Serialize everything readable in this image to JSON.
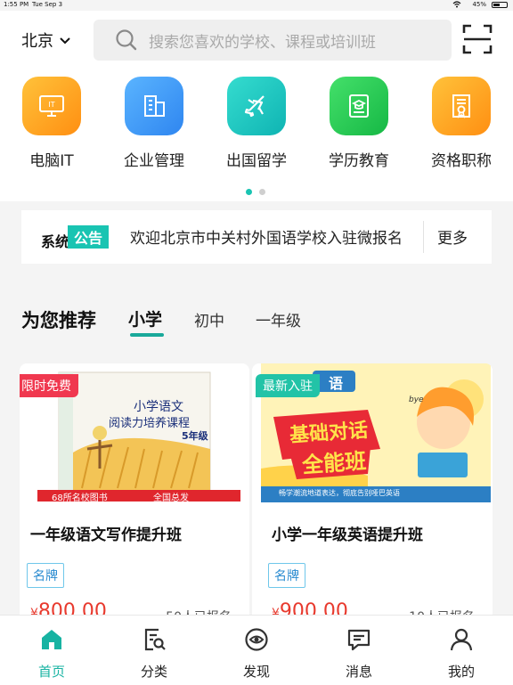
{
  "status_bar": {
    "time": "1:55 PM",
    "date": "Tue Sep 3",
    "battery": "45%"
  },
  "header": {
    "city": "北京",
    "search_placeholder": "搜索您喜欢的学校、课程或培训班"
  },
  "categories": [
    {
      "label": "电脑IT",
      "icon": "computer-it-icon",
      "color": "#ffa21a"
    },
    {
      "label": "企业管理",
      "icon": "buildings-icon",
      "color": "#3d9bf7"
    },
    {
      "label": "出国留学",
      "icon": "airplane-icon",
      "color": "#18c8c1"
    },
    {
      "label": "学历教育",
      "icon": "graduation-book-icon",
      "color": "#2ecb4f"
    },
    {
      "label": "资格职称",
      "icon": "certificate-icon",
      "color": "#ffa21a"
    }
  ],
  "notice": {
    "label_part1": "系统",
    "label_part2": "公告",
    "text": "欢迎北京市中关村外国语学校入驻微报名",
    "more": "更多"
  },
  "recommend": {
    "title": "为您推荐",
    "tabs": [
      "小学",
      "初中",
      "一年级"
    ],
    "active_tab": 0
  },
  "courses": [
    {
      "badge": "限时免费",
      "badge_color": "#f0384f",
      "title": "一年级语文写作提升班",
      "tag": "名牌",
      "price": "800.00",
      "currency": "¥",
      "enrolled": "50人已报名",
      "cover": {
        "book_title_1": "小学语文",
        "book_title_2": "阅读力培养课程",
        "grade": "5年级",
        "banner_left": "68所名校图书",
        "banner_right": "全国总发"
      }
    },
    {
      "badge": "最新入驻",
      "badge_color": "#22c3a7",
      "title": "小学一年级英语提升班",
      "tag": "名牌",
      "price": "900.00",
      "currency": "¥",
      "enrolled": "10人已报名",
      "cover": {
        "corner_word": "语",
        "headline_1": "基础对话",
        "headline_2": "全能班",
        "slogan": "畅学潮流地道表达，彻底告别哑巴英语",
        "bubble": "bye"
      }
    }
  ],
  "tabbar": [
    {
      "label": "首页",
      "icon": "home-icon",
      "active": true
    },
    {
      "label": "分类",
      "icon": "category-search-icon",
      "active": false
    },
    {
      "label": "发现",
      "icon": "discover-eye-icon",
      "active": false
    },
    {
      "label": "消息",
      "icon": "message-icon",
      "active": false
    },
    {
      "label": "我的",
      "icon": "profile-icon",
      "active": false
    }
  ],
  "colors": {
    "accent": "#19c4b2",
    "price": "#e83a2e"
  }
}
